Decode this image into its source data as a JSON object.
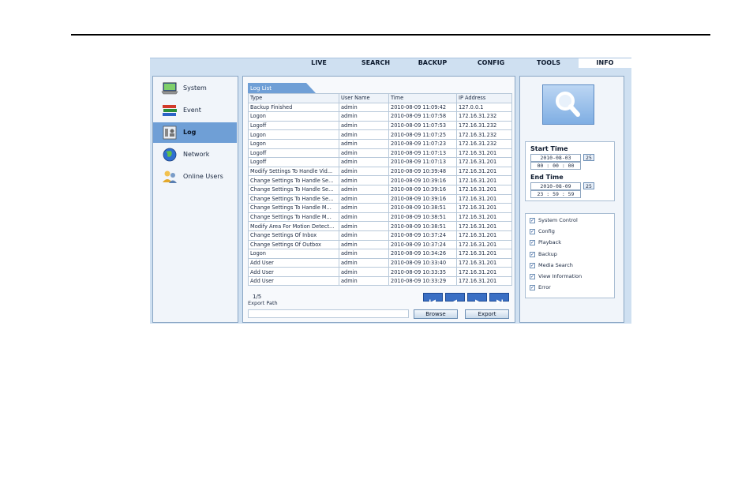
{
  "nav": {
    "items": [
      "LIVE",
      "SEARCH",
      "BACKUP",
      "CONFIG",
      "TOOLS",
      "INFO"
    ],
    "active": "INFO"
  },
  "sidebar": {
    "items": [
      {
        "label": "System",
        "icon": "laptop-icon"
      },
      {
        "label": "Event",
        "icon": "books-icon"
      },
      {
        "label": "Log",
        "icon": "log-icon",
        "active": true
      },
      {
        "label": "Network",
        "icon": "globe-icon"
      },
      {
        "label": "Online Users",
        "icon": "users-icon"
      }
    ]
  },
  "log": {
    "tab_label": "Log List",
    "columns": [
      "Type",
      "User Name",
      "Time",
      "IP Address"
    ],
    "rows": [
      [
        "Backup Finished",
        "admin",
        "2010-08-09 11:09:42",
        "127.0.0.1"
      ],
      [
        "Logon",
        "admin",
        "2010-08-09 11:07:58",
        "172.16.31.232"
      ],
      [
        "Logoff",
        "admin",
        "2010-08-09 11:07:53",
        "172.16.31.232"
      ],
      [
        "Logon",
        "admin",
        "2010-08-09 11:07:25",
        "172.16.31.232"
      ],
      [
        "Logon",
        "admin",
        "2010-08-09 11:07:23",
        "172.16.31.232"
      ],
      [
        "Logoff",
        "admin",
        "2010-08-09 11:07:13",
        "172.16.31.201"
      ],
      [
        "Logoff",
        "admin",
        "2010-08-09 11:07:13",
        "172.16.31.201"
      ],
      [
        "Modify Settings To Handle Vid...",
        "admin",
        "2010-08-09 10:39:48",
        "172.16.31.201"
      ],
      [
        "Change Settings To Handle Se...",
        "admin",
        "2010-08-09 10:39:16",
        "172.16.31.201"
      ],
      [
        "Change Settings To Handle Se...",
        "admin",
        "2010-08-09 10:39:16",
        "172.16.31.201"
      ],
      [
        "Change Settings To Handle Se...",
        "admin",
        "2010-08-09 10:39:16",
        "172.16.31.201"
      ],
      [
        "Change Settings To Handle M...",
        "admin",
        "2010-08-09 10:38:51",
        "172.16.31.201"
      ],
      [
        "Change Settings To Handle M...",
        "admin",
        "2010-08-09 10:38:51",
        "172.16.31.201"
      ],
      [
        "Modify Area For Motion Detect...",
        "admin",
        "2010-08-09 10:38:51",
        "172.16.31.201"
      ],
      [
        "Change Settings Of Inbox",
        "admin",
        "2010-08-09 10:37:24",
        "172.16.31.201"
      ],
      [
        "Change Settings Of Outbox",
        "admin",
        "2010-08-09 10:37:24",
        "172.16.31.201"
      ],
      [
        "Logon",
        "admin",
        "2010-08-09 10:34:26",
        "172.16.31.201"
      ],
      [
        "Add User",
        "admin",
        "2010-08-09 10:33:40",
        "172.16.31.201"
      ],
      [
        "Add User",
        "admin",
        "2010-08-09 10:33:35",
        "172.16.31.201"
      ],
      [
        "Add User",
        "admin",
        "2010-08-09 10:33:29",
        "172.16.31.201"
      ]
    ],
    "page_indicator": "1/5",
    "export_path_label": "Export Path",
    "export_path_value": "",
    "browse_label": "Browse",
    "export_label": "Export"
  },
  "search": {
    "start_label": "Start Time",
    "start_date": "2010-08-03",
    "start_time": "00 : 00 : 00",
    "end_label": "End Time",
    "end_date": "2010-08-09",
    "end_time": "23 : 59 : 59",
    "calendar_label": "25",
    "filters": [
      {
        "label": "System Control",
        "checked": true
      },
      {
        "label": "Config",
        "checked": true
      },
      {
        "label": "Playback",
        "checked": true
      },
      {
        "label": "Backup",
        "checked": true
      },
      {
        "label": "Media Search",
        "checked": true
      },
      {
        "label": "View Information",
        "checked": true
      },
      {
        "label": "Error",
        "checked": true
      }
    ]
  },
  "colors": {
    "accent": "#6f9fd6",
    "pager_button": "#3a6fc4",
    "frame": "#cfe0f1"
  }
}
